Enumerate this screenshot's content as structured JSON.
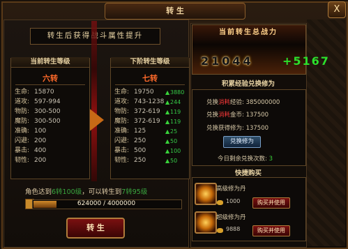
{
  "window": {
    "title": "转 生",
    "close_label": "X"
  },
  "banner": "转生后获得战斗属性提升",
  "current": {
    "header": "当前转生等级",
    "level": "六转",
    "stats": [
      {
        "name": "生命:",
        "value": "15870"
      },
      {
        "name": "道攻:",
        "value": "597-994"
      },
      {
        "name": "物防:",
        "value": "300-500"
      },
      {
        "name": "魔防:",
        "value": "300-500"
      },
      {
        "name": "准确:",
        "value": "100"
      },
      {
        "name": "闪避:",
        "value": "200"
      },
      {
        "name": "暴击:",
        "value": "400"
      },
      {
        "name": "韧性:",
        "value": "200"
      }
    ]
  },
  "next": {
    "header": "下阶转生等级",
    "level": "七转",
    "stats": [
      {
        "name": "生命:",
        "value": "19750",
        "inc": "3880"
      },
      {
        "name": "道攻:",
        "value": "743-1238",
        "inc": "244"
      },
      {
        "name": "物防:",
        "value": "372-619",
        "inc": "119"
      },
      {
        "name": "魔防:",
        "value": "372-619",
        "inc": "119"
      },
      {
        "name": "准确:",
        "value": "125",
        "inc": "25"
      },
      {
        "name": "闪避:",
        "value": "250",
        "inc": "50"
      },
      {
        "name": "暴击:",
        "value": "500",
        "inc": "100"
      },
      {
        "name": "韧性:",
        "value": "250",
        "inc": "50"
      }
    ]
  },
  "bottom": {
    "text1": "角色达到",
    "hl1": "6转100级",
    "text2": "，可以转生到",
    "hl2": "7转95级"
  },
  "progress": {
    "current": "624000",
    "max": "4000000",
    "text": "624000 / 4000000",
    "fraction": 0.156
  },
  "rebirth_button": "转 生",
  "power": {
    "title": "当前转生总战力",
    "value": "21044",
    "plus": "+5167"
  },
  "exchange": {
    "title": "积累经验兑换修为",
    "row1_a": "兑换",
    "row1_red": "消耗",
    "row1_b": "经验: 385000000",
    "row2_a": "兑换",
    "row2_red": "消耗",
    "row2_b": "金币: 137500",
    "row3": "兑换获得修为: 137500",
    "button": "兑换修为",
    "remain_label": "今日剩余兑换次数:",
    "remain_value": "3"
  },
  "shop": {
    "title": "快捷购买",
    "items": [
      {
        "name": "高级修为丹",
        "price": "1000",
        "button": "购买并使用"
      },
      {
        "name": "超级修为丹",
        "price": "9888",
        "button": "购买并使用"
      }
    ]
  },
  "colors": {
    "accent": "#b07c3b",
    "level": "#ff6a2a",
    "increase": "#39d43b"
  }
}
